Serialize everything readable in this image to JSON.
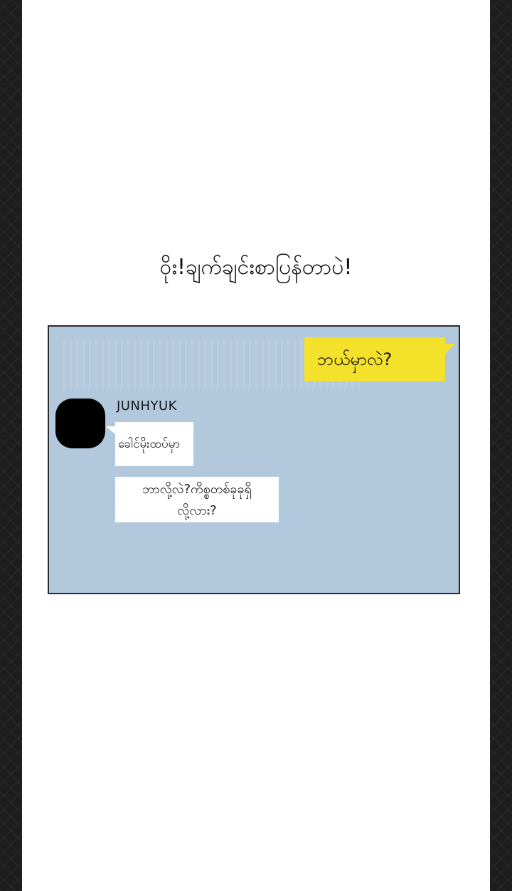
{
  "caption": "ဝိုး!ချက်ချင်းစာပြန်တာပဲ!",
  "chat": {
    "outgoing_message": "ဘယ်မှာလဲ?",
    "contact_name": "JUNHYUK",
    "incoming_messages": [
      "ခေါင်မိုးထပ်မှာ",
      "ဘာလို့လဲ?ကိစ္စတစ်ခုခုရှိ",
      "လို့လား?"
    ]
  },
  "colors": {
    "panel_background": "#b2c8dd",
    "outgoing_bubble": "#f4e12a",
    "incoming_bubble": "#ffffff",
    "avatar": "#000000"
  }
}
